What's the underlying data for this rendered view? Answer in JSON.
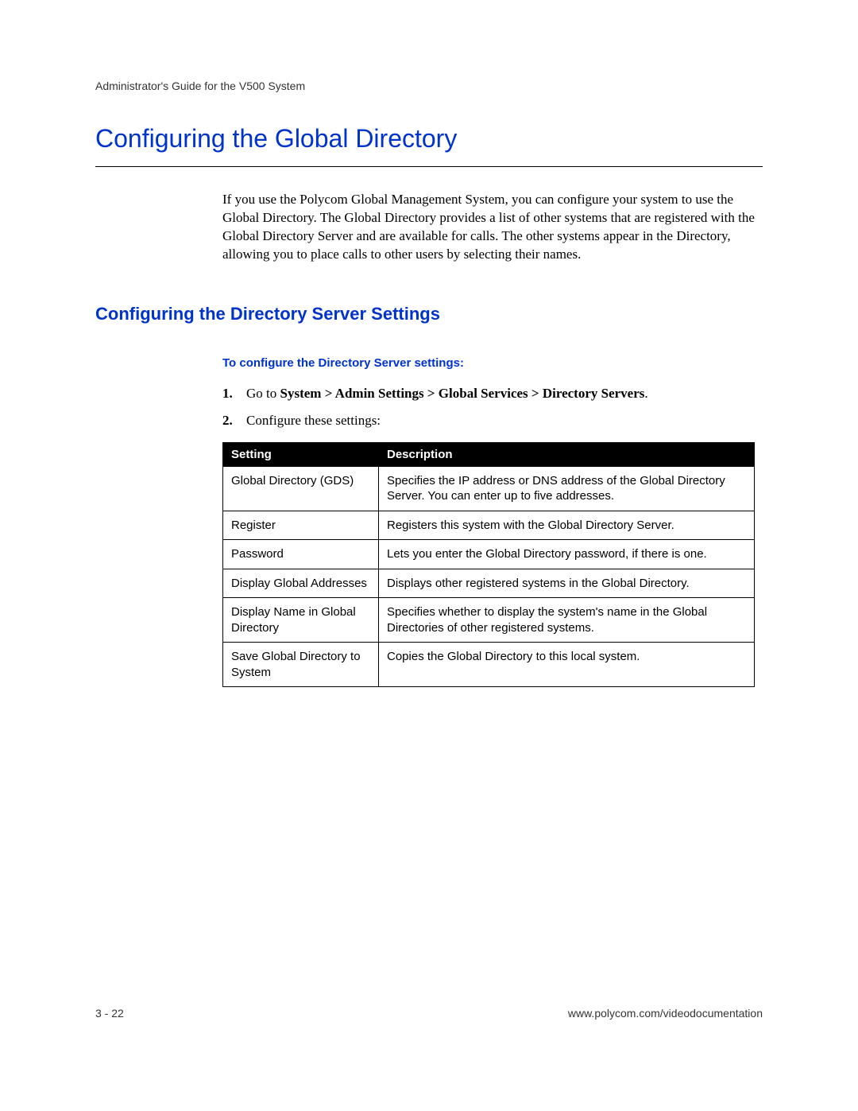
{
  "header": {
    "guide_title": "Administrator's Guide for the V500 System"
  },
  "h1": "Configuring the Global Directory",
  "intro": "If you use the Polycom Global Management System, you can configure your system to use the Global Directory. The Global Directory provides a list of other systems that are registered with the Global Directory Server and are available for calls. The other systems appear in the Directory, allowing you to place calls to other users by selecting their names.",
  "h2": "Configuring the Directory Server Settings",
  "h3": "To configure the Directory Server settings:",
  "steps": {
    "s1_num": "1.",
    "s1_prefix": "Go to ",
    "s1_bold": "System > Admin Settings > Global Services > Directory Servers",
    "s1_suffix": ".",
    "s2_num": "2.",
    "s2_text": "Configure these settings:"
  },
  "table": {
    "col1": "Setting",
    "col2": "Description",
    "rows": [
      {
        "setting": "Global Directory (GDS)",
        "desc": "Specifies the IP address or DNS address of the Global Directory Server. You can enter up to five addresses."
      },
      {
        "setting": "Register",
        "desc": "Registers this system with the Global Directory Server."
      },
      {
        "setting": "Password",
        "desc": "Lets you enter the Global Directory password, if there is one."
      },
      {
        "setting": "Display Global Addresses",
        "desc": "Displays other registered systems in the Global Directory."
      },
      {
        "setting": "Display Name in Global Directory",
        "desc": "Specifies whether to display the system's name in the Global Directories of other registered systems."
      },
      {
        "setting": "Save Global Directory to System",
        "desc": "Copies the Global Directory to this local system."
      }
    ]
  },
  "footer": {
    "page": "3 - 22",
    "url": "www.polycom.com/videodocumentation"
  }
}
